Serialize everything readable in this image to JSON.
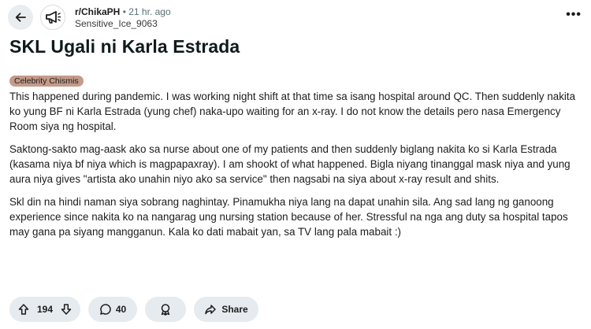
{
  "header": {
    "subreddit": "r/ChikaPH",
    "separator": "•",
    "time": "21 hr. ago",
    "username": "Sensitive_Ice_9063",
    "back_icon": "arrow-left-icon",
    "avatar_icon": "megaphone-icon",
    "more_icon": "ellipsis-icon"
  },
  "post": {
    "title": "SKL Ugali ni Karla Estrada",
    "flair": "Celebrity Chismis",
    "flair_color": "#c49a8a",
    "paragraphs": [
      "This happened during pandemic. I was working night shift at that time sa isang hospital around QC. Then suddenly nakita ko yung BF ni Karla Estrada (yung chef) naka-upo waiting for an x-ray. I do not know the details pero nasa Emergency Room siya ng hospital.",
      "Saktong-sakto mag-aask ako sa nurse about one of my patients and then suddenly biglang nakita ko si Karla Estrada (kasama niya bf niya which is magpapaxray). I am shookt of what happened. Bigla niyang tinanggal mask niya and yung aura niya gives \"artista ako unahin niyo ako sa service\" then nagsabi na siya about x-ray result and shits.",
      "Skl din na hindi naman siya sobrang naghintay. Pinamukha niya lang na dapat unahin sila. Ang sad lang ng ganoong experience since nakita ko na nangarag ung nursing station because of her. Stressful na nga ang duty sa hospital tapos may gana pa siyang mangganun. Kala ko dati mabait yan, sa TV lang pala mabait :)"
    ]
  },
  "actions": {
    "votes": "194",
    "comments": "40",
    "share_label": "Share"
  }
}
